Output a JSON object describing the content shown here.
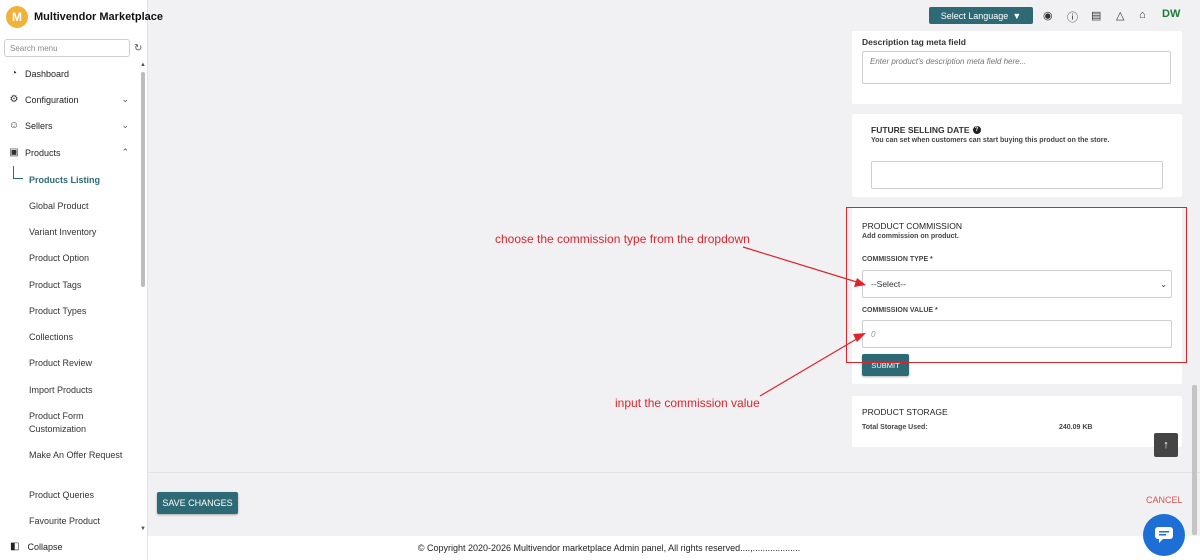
{
  "app": {
    "logo_letter": "M",
    "name": "Multivendor Marketplace"
  },
  "sidebar": {
    "search_placeholder": "Search menu",
    "items": [
      {
        "label": "Dashboard",
        "icon": "dashboard-icon",
        "glyph": "◔"
      },
      {
        "label": "Configuration",
        "icon": "gear-icon",
        "glyph": "⚙"
      },
      {
        "label": "Sellers",
        "icon": "user-icon",
        "glyph": "☺"
      },
      {
        "label": "Products",
        "icon": "box-icon",
        "glyph": "▣"
      }
    ],
    "sub_items": [
      "Products Listing",
      "Global Product",
      "Variant Inventory",
      "Product Option",
      "Product Tags",
      "Product Types",
      "Collections",
      "Product Review",
      "Import Products",
      "Product Form Customization",
      "Make An Offer Request",
      "Product Queries",
      "Favourite Product"
    ],
    "collapse_label": "Collapse"
  },
  "topbar": {
    "language_label": "Select Language",
    "user_initials": "DW"
  },
  "description_card": {
    "label": "Description tag meta field",
    "placeholder": "Enter product's description meta field here..."
  },
  "future_card": {
    "title": "FUTURE SELLING DATE",
    "subtitle": "You can set when customers can start buying this product on the store."
  },
  "commission_card": {
    "title": "PRODUCT COMMISSION",
    "subtitle": "Add commission on product.",
    "type_label": "COMMISSION TYPE *",
    "type_selected": "--Select--",
    "value_label": "COMMISSION VALUE *",
    "value_placeholder": "0",
    "submit_label": "SUBMIT"
  },
  "storage_card": {
    "title": "PRODUCT STORAGE",
    "label": "Total Storage Used:",
    "value": "240.09 KB"
  },
  "annotations": {
    "dropdown_note": "choose the commission type from the dropdown",
    "value_note": "input the commission value",
    "color": "#e0232b"
  },
  "footer": {
    "save_label": "SAVE CHANGES",
    "cancel_label": "CANCEL",
    "copyright": "© Copyright 2020-2026 Multivendor marketplace Admin panel, All rights reserved....,..................."
  },
  "colors": {
    "accent": "#2e6a75",
    "brand_logo": "#f0b23a",
    "chat": "#1d6fd6",
    "cancel": "#d9534f"
  }
}
